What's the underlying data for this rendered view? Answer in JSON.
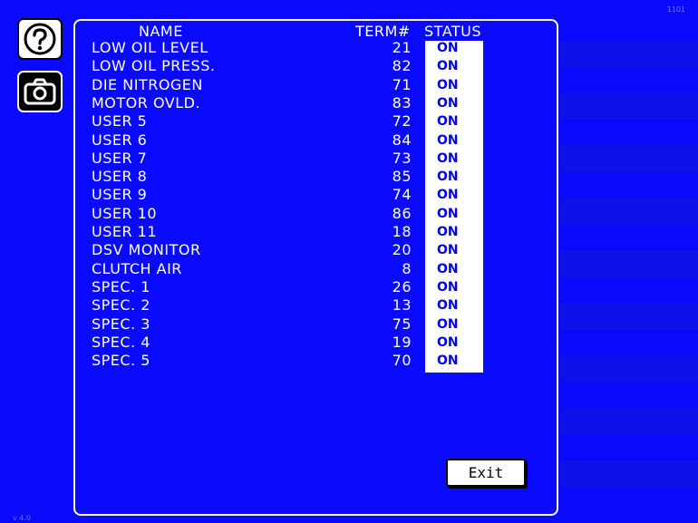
{
  "corner_label": "1101",
  "bottom_label": "v 4.0",
  "help_button": {
    "icon": "help-icon"
  },
  "camera_button": {
    "icon": "camera-icon"
  },
  "headers": {
    "name": "NAME",
    "term": "TERM#",
    "status": "STATUS"
  },
  "rows": [
    {
      "name": "LOW OIL LEVEL",
      "term": "21",
      "status": "ON"
    },
    {
      "name": "LOW OIL PRESS.",
      "term": "82",
      "status": "ON"
    },
    {
      "name": "DIE NITROGEN",
      "term": "71",
      "status": "ON"
    },
    {
      "name": "MOTOR OVLD.",
      "term": "83",
      "status": "ON"
    },
    {
      "name": "USER 5",
      "term": "72",
      "status": "ON"
    },
    {
      "name": "USER 6",
      "term": "84",
      "status": "ON"
    },
    {
      "name": "USER 7",
      "term": "73",
      "status": "ON"
    },
    {
      "name": "USER 8",
      "term": "85",
      "status": "ON"
    },
    {
      "name": "USER 9",
      "term": "74",
      "status": "ON"
    },
    {
      "name": "USER 10",
      "term": "86",
      "status": "ON"
    },
    {
      "name": "USER 11",
      "term": "18",
      "status": "ON"
    },
    {
      "name": "DSV MONITOR",
      "term": "20",
      "status": "ON"
    },
    {
      "name": "CLUTCH AIR",
      "term": "8",
      "status": "ON"
    },
    {
      "name": "SPEC. 1",
      "term": "26",
      "status": "ON"
    },
    {
      "name": "SPEC. 2",
      "term": "13",
      "status": "ON"
    },
    {
      "name": "SPEC. 3",
      "term": "75",
      "status": "ON"
    },
    {
      "name": "SPEC. 4",
      "term": "19",
      "status": "ON"
    },
    {
      "name": "SPEC. 5",
      "term": "70",
      "status": "ON"
    }
  ],
  "exit_label": "Exit",
  "colors": {
    "background": "#0a0aff",
    "status_text": "#0000ee"
  }
}
